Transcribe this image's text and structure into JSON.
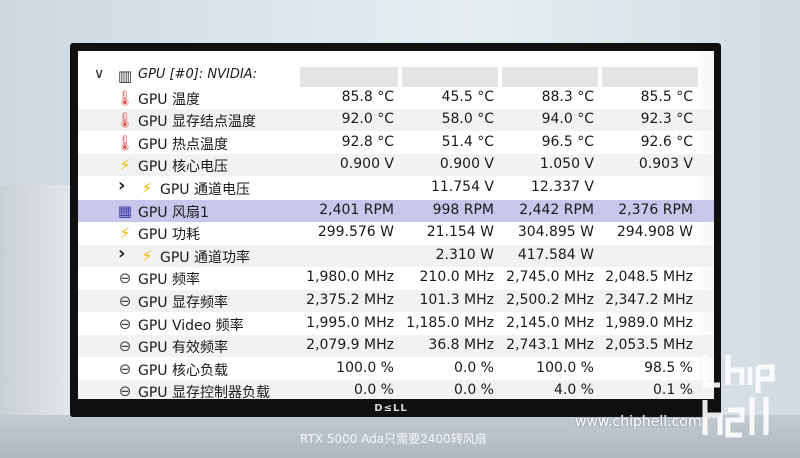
{
  "header": {
    "label": "GPU [#0]: NVIDIA:",
    "icon": "chip-icon"
  },
  "rows": [
    {
      "icon": "thermometer-icon",
      "label": "GPU 温度",
      "values": [
        "85.8 °C",
        "45.5 °C",
        "88.3 °C",
        "85.5 °C"
      ]
    },
    {
      "icon": "thermometer-icon",
      "label": "GPU 显存结点温度",
      "values": [
        "92.0 °C",
        "58.0 °C",
        "94.0 °C",
        "92.3 °C"
      ]
    },
    {
      "icon": "thermometer-icon",
      "label": "GPU 热点温度",
      "values": [
        "92.8 °C",
        "51.4 °C",
        "96.5 °C",
        "92.6 °C"
      ]
    },
    {
      "icon": "lightning-icon",
      "label": "GPU 核心电压",
      "values": [
        "0.900 V",
        "0.900 V",
        "1.050 V",
        "0.903 V"
      ]
    },
    {
      "icon": "lightning-icon",
      "label": "GPU 通道电压",
      "values": [
        "",
        "11.754 V",
        "12.337 V",
        ""
      ],
      "expandable": true
    },
    {
      "icon": "fan-icon",
      "label": "GPU 风扇1",
      "values": [
        "2,401 RPM",
        "998 RPM",
        "2,442 RPM",
        "2,376 RPM"
      ],
      "selected": true
    },
    {
      "icon": "lightning-icon",
      "label": "GPU 功耗",
      "values": [
        "299.576 W",
        "21.154 W",
        "304.895 W",
        "294.908 W"
      ]
    },
    {
      "icon": "lightning-icon",
      "label": "GPU 通道功率",
      "values": [
        "",
        "2.310 W",
        "417.584 W",
        ""
      ],
      "expandable": true
    },
    {
      "icon": "clock-icon",
      "label": "GPU 频率",
      "values": [
        "1,980.0 MHz",
        "210.0 MHz",
        "2,745.0 MHz",
        "2,048.5 MHz"
      ]
    },
    {
      "icon": "clock-icon",
      "label": "GPU 显存频率",
      "values": [
        "2,375.2 MHz",
        "101.3 MHz",
        "2,500.2 MHz",
        "2,347.2 MHz"
      ]
    },
    {
      "icon": "clock-icon",
      "label": "GPU Video 频率",
      "values": [
        "1,995.0 MHz",
        "1,185.0 MHz",
        "2,145.0 MHz",
        "1,989.0 MHz"
      ]
    },
    {
      "icon": "clock-icon",
      "label": "GPU 有效频率",
      "values": [
        "2,079.9 MHz",
        "36.8 MHz",
        "2,743.1 MHz",
        "2,053.5 MHz"
      ]
    },
    {
      "icon": "clock-icon",
      "label": "GPU 核心负载",
      "values": [
        "100.0 %",
        "0.0 %",
        "100.0 %",
        "98.5 %"
      ]
    },
    {
      "icon": "clock-icon",
      "label": "GPU 显存控制器负载",
      "values": [
        "0.0 %",
        "0.0 %",
        "4.0 %",
        "0.1 %"
      ]
    }
  ],
  "monitor_brand": "D≤LL",
  "caption": "RTX 5000 Ada只需要2400转风扇",
  "site": "www.chiphell.com",
  "colors": {
    "selected_row": "#c9c6ec",
    "alt_row": "#f2f2f2",
    "temp_icon": "#d9534f",
    "volt_icon": "#f0b400",
    "fan_icon": "#3a3aa0"
  }
}
